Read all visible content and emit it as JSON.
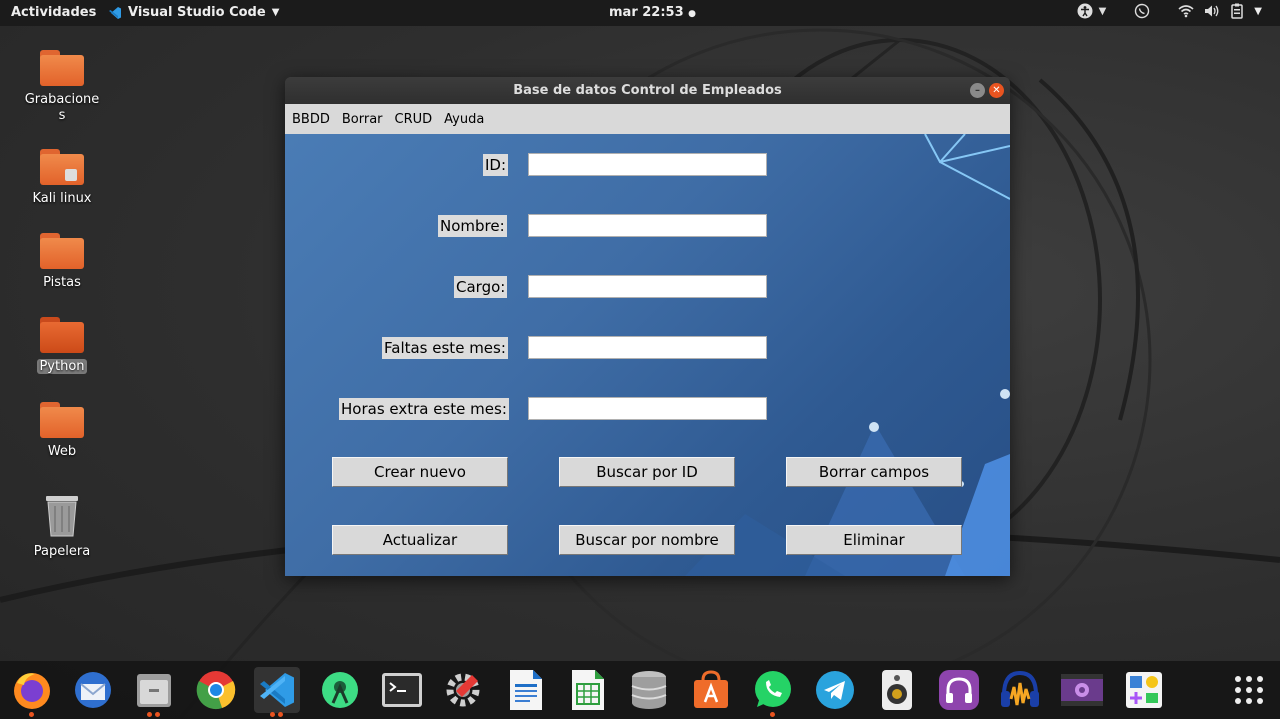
{
  "topbar": {
    "activities": "Actividades",
    "app_name": "Visual Studio Code",
    "clock": "mar 22:53"
  },
  "desktop": {
    "icons": [
      {
        "label": "Grabacione\ns"
      },
      {
        "label": "Kali linux"
      },
      {
        "label": "Pistas"
      },
      {
        "label": "Python"
      },
      {
        "label": "Web"
      },
      {
        "label": "Papelera"
      }
    ]
  },
  "window": {
    "title": "Base de datos Control de Empleados",
    "menu": [
      "BBDD",
      "Borrar",
      "CRUD",
      "Ayuda"
    ],
    "fields": [
      {
        "label": "ID:",
        "value": ""
      },
      {
        "label": "Nombre:",
        "value": ""
      },
      {
        "label": "Cargo:",
        "value": ""
      },
      {
        "label": "Faltas este mes:",
        "value": ""
      },
      {
        "label": "Horas extra este mes:",
        "value": ""
      }
    ],
    "buttons": {
      "create": "Crear nuevo",
      "search_id": "Buscar por ID",
      "clear": "Borrar campos",
      "update": "Actualizar",
      "search_name": "Buscar por nombre",
      "delete": "Eliminar"
    }
  },
  "dock": {
    "apps": [
      "firefox-icon",
      "thunderbird-icon",
      "files-icon",
      "chrome-icon",
      "vscode-icon",
      "android-studio-icon",
      "terminal-icon",
      "settings-tools-icon",
      "libreoffice-writer-icon",
      "libreoffice-calc-icon",
      "database-icon",
      "software-store-icon",
      "whatsapp-icon",
      "telegram-icon",
      "speaker-icon",
      "headphones-icon",
      "audacity-icon",
      "video-icon",
      "apps-misc-icon",
      "show-apps-grid-icon"
    ]
  }
}
